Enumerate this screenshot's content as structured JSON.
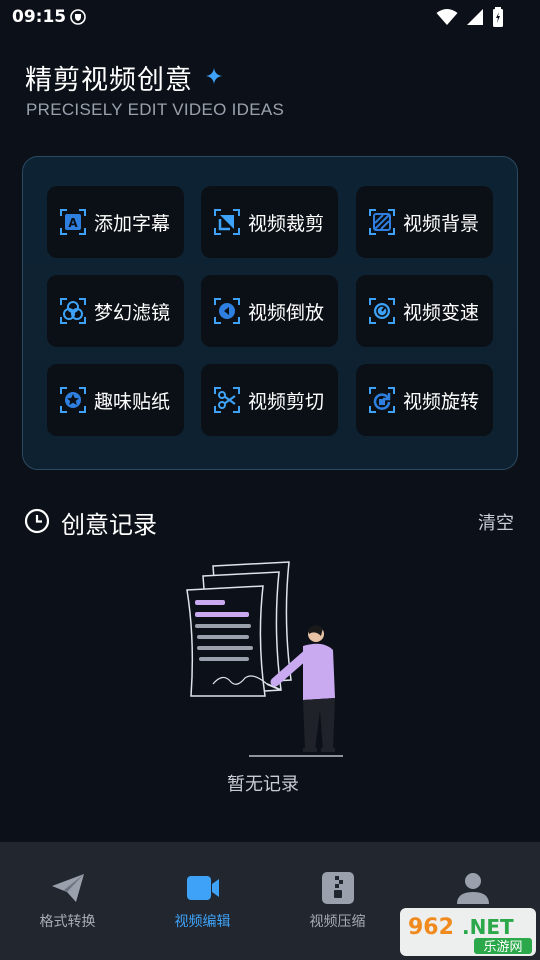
{
  "status": {
    "time": "09:15"
  },
  "header": {
    "title": "精剪视频创意",
    "subtitle": "PRECISELY EDIT VIDEO IDEAS"
  },
  "tools": [
    {
      "label": "添加字幕",
      "icon": "subtitle-icon"
    },
    {
      "label": "视频裁剪",
      "icon": "crop-icon"
    },
    {
      "label": "视频背景",
      "icon": "background-icon"
    },
    {
      "label": "梦幻滤镜",
      "icon": "filter-icon"
    },
    {
      "label": "视频倒放",
      "icon": "reverse-icon"
    },
    {
      "label": "视频变速",
      "icon": "speed-icon"
    },
    {
      "label": "趣味贴纸",
      "icon": "sticker-icon"
    },
    {
      "label": "视频剪切",
      "icon": "scissors-icon"
    },
    {
      "label": "视频旋转",
      "icon": "rotate-icon"
    }
  ],
  "records": {
    "title": "创意记录",
    "clear_label": "清空",
    "empty_text": "暂无记录"
  },
  "nav": [
    {
      "label": "格式转换",
      "icon": "paper-plane-icon",
      "active": false
    },
    {
      "label": "视频编辑",
      "icon": "video-camera-icon",
      "active": true
    },
    {
      "label": "视频压缩",
      "icon": "archive-icon",
      "active": false
    },
    {
      "label": "",
      "icon": "user-icon",
      "active": false
    }
  ],
  "watermark": {
    "logo_text": "962.NET",
    "sub_text": "乐游网"
  },
  "colors": {
    "accent": "#3ea3f8",
    "background": "#0c1119",
    "panel": "#0d2233",
    "nav": "#22262f"
  }
}
